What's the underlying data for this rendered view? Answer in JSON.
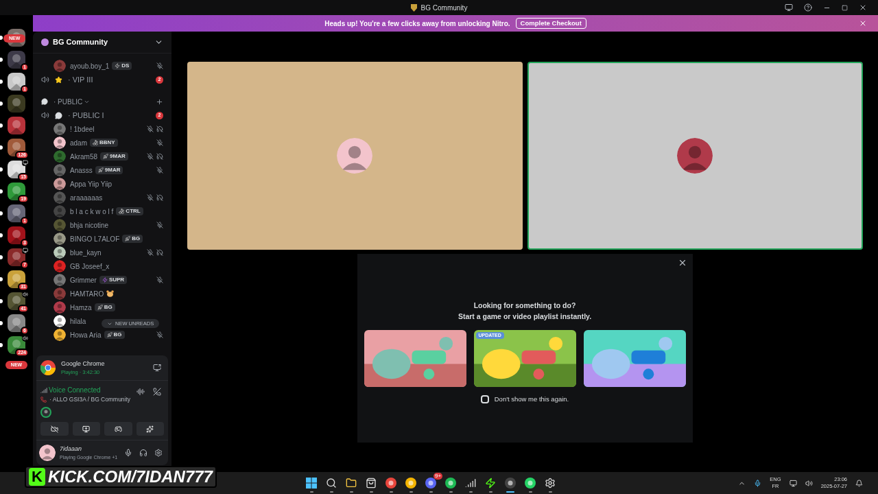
{
  "title_bar": {
    "title": "BG Community"
  },
  "banner": {
    "message": "Heads up! You're a few clicks away from unlocking Nitro.",
    "button": "Complete Checkout"
  },
  "server_rail": {
    "top_pill": "NEW",
    "bottom_pill": "NEW",
    "servers": [
      {
        "unread": true
      },
      {
        "unread": true,
        "badge": "1"
      },
      {
        "unread": true,
        "badge": "1"
      },
      {
        "unread": true
      },
      {
        "unread": true
      },
      {
        "unread": true,
        "badge": "126"
      },
      {
        "unread": true,
        "badge": "15",
        "screen_sharing": true
      },
      {
        "unread": true,
        "badge": "19"
      },
      {
        "unread": true,
        "badge": "1"
      },
      {
        "unread": true,
        "badge": "3"
      },
      {
        "unread": true,
        "badge": "7",
        "screen_sharing": true
      },
      {
        "unread": true,
        "badge": "31"
      },
      {
        "unread": true,
        "badge": "41",
        "in_voice": true
      },
      {
        "unread": true,
        "badge": "6"
      },
      {
        "unread": true,
        "badge": "224",
        "in_voice": true
      }
    ]
  },
  "sidebar": {
    "server_name": "BG Community",
    "items": [
      {
        "kind": "member",
        "name": "ayoub.boy_1",
        "tag": {
          "kind": "bolt",
          "text": "DS"
        },
        "muted": true,
        "deafened": false
      },
      {
        "kind": "starred_voice_channel",
        "name": "· VIP III",
        "badge": "2"
      },
      {
        "kind": "category",
        "name": "· PUBLIC"
      },
      {
        "kind": "chat_voice_channel",
        "name": "· PUBLIC I",
        "badge": "2"
      },
      {
        "kind": "member",
        "name": "! 1bdeel",
        "muted": true,
        "deafened": true
      },
      {
        "kind": "member",
        "name": "adam",
        "tag": {
          "kind": "fruit",
          "text": "BBNY"
        },
        "muted": true,
        "deafened": false
      },
      {
        "kind": "member",
        "name": "Akram58",
        "tag": {
          "kind": "rocket",
          "text": "9MAR"
        },
        "muted": true,
        "deafened": true
      },
      {
        "kind": "member",
        "name": "Anasss",
        "tag": {
          "kind": "rocket",
          "text": "9MAR"
        },
        "muted": true,
        "deafened": false
      },
      {
        "kind": "member",
        "name": "Appa Yiip Yiip",
        "muted": false,
        "deafened": false
      },
      {
        "kind": "member",
        "name": "araaaaaas",
        "muted": true,
        "deafened": true
      },
      {
        "kind": "member",
        "name": "b l a c k w o l f",
        "tag": {
          "kind": "fruit",
          "text": "CTRL"
        },
        "muted": false,
        "deafened": false
      },
      {
        "kind": "member",
        "name": "bhja nicotine",
        "muted": true,
        "deafened": false
      },
      {
        "kind": "member",
        "name": "BINGO L7ALOF",
        "tag": {
          "kind": "rocket",
          "text": "BG"
        },
        "muted": false,
        "deafened": false
      },
      {
        "kind": "member",
        "name": "blue_kayn",
        "muted": true,
        "deafened": true
      },
      {
        "kind": "member",
        "name": "GB Joseef_x",
        "muted": false,
        "deafened": false
      },
      {
        "kind": "member",
        "name": "Grimmer",
        "tag": {
          "kind": "bolt",
          "text": "SUPR"
        },
        "muted": true,
        "deafened": false
      },
      {
        "kind": "member_with_hamster",
        "name": "HAMTARO",
        "muted": false,
        "deafened": false
      },
      {
        "kind": "member",
        "name": "Hamza",
        "tag": {
          "kind": "rocket",
          "text": "BG"
        },
        "muted": false,
        "deafened": false
      },
      {
        "kind": "member",
        "name": "hilala",
        "muted": false,
        "deafened": false
      },
      {
        "kind": "member",
        "name": "Howa Aria",
        "tag": {
          "kind": "rocket",
          "text": "BG"
        },
        "muted": true,
        "deafened": false
      }
    ],
    "new_unreads": "NEW UNREADS"
  },
  "activity": {
    "app": "Google Chrome",
    "status": "Playing · 3:42:30"
  },
  "voice": {
    "status": "Voice Connected",
    "channel": "· ALLO GSI3A / BG Community"
  },
  "user": {
    "name": "7idaaan",
    "status": "Playing Google Chrome +1"
  },
  "video_tiles": [
    {
      "color": "#d4b68a",
      "speaking": false
    },
    {
      "color": "#c9c9c9",
      "speaking": true
    }
  ],
  "activity_popup": {
    "heading": "Looking for something to do?",
    "subheading": "Start a game or video playlist instantly.",
    "cards": [
      {
        "kind": "picture"
      },
      {
        "kind": "picture",
        "badge": "UPDATED"
      },
      {
        "kind": "picture"
      }
    ],
    "checkbox": {
      "label": "Don't show me this again.",
      "checked": false
    }
  },
  "overlay": {
    "logo": "K",
    "text": "KICK.COM/7IDAN777"
  },
  "taskbar": {
    "apps": [
      {
        "kind": "start",
        "selected": false
      },
      {
        "kind": "search",
        "selected": false
      },
      {
        "kind": "folder",
        "selected": false
      },
      {
        "kind": "store",
        "selected": false
      },
      {
        "kind": "chrome",
        "selected": false
      },
      {
        "kind": "stack",
        "selected": false
      },
      {
        "kind": "discord",
        "badge": "9+",
        "selected": false
      },
      {
        "kind": "spotify",
        "selected": false
      },
      {
        "kind": "camera",
        "selected": false
      },
      {
        "kind": "play",
        "selected": false
      },
      {
        "kind": "obs",
        "selected": true
      },
      {
        "kind": "whatsapp",
        "selected": false
      },
      {
        "kind": "settings",
        "selected": false
      }
    ],
    "language": "ENG",
    "layout": "FR",
    "time": "23:06",
    "date": "2025-07-27"
  }
}
